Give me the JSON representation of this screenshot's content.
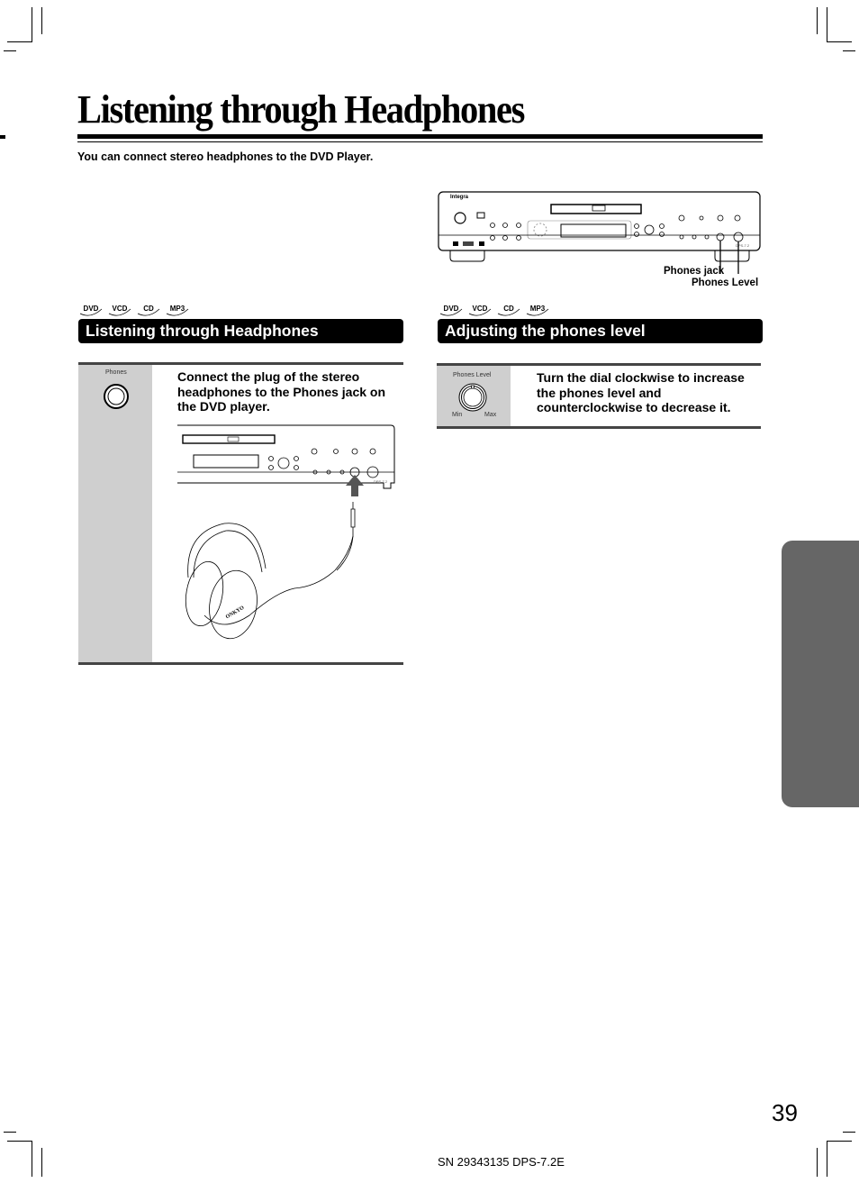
{
  "page": {
    "title": "Listening through Headphones",
    "intro": "You can connect stereo headphones to the DVD Player.",
    "page_number": "39",
    "footer": "SN 29343135 DPS-7.2E"
  },
  "overview_figure": {
    "brand": "Integra",
    "model": "DPS-7.2",
    "callouts": [
      "Phones jack",
      "Phones Level"
    ]
  },
  "disc_logos": [
    "DVD",
    "VCD",
    "CD",
    "MP3"
  ],
  "sections": [
    {
      "heading": "Listening through Headphones",
      "icon_label": "Phones",
      "icon": "phones-jack-icon",
      "instruction": "Connect the plug of the stereo headphones to the Phones jack on the DVD player.",
      "figure_model": "DPS-7.2",
      "headphone_brand": "ONKYO"
    },
    {
      "heading": "Adjusting the phones level",
      "icon_label": "Phones Level",
      "icon": "volume-knob-icon",
      "knob_min": "Min",
      "knob_max": "Max",
      "instruction": "Turn the dial clockwise to increase the phones level and counterclockwise to decrease it."
    }
  ]
}
